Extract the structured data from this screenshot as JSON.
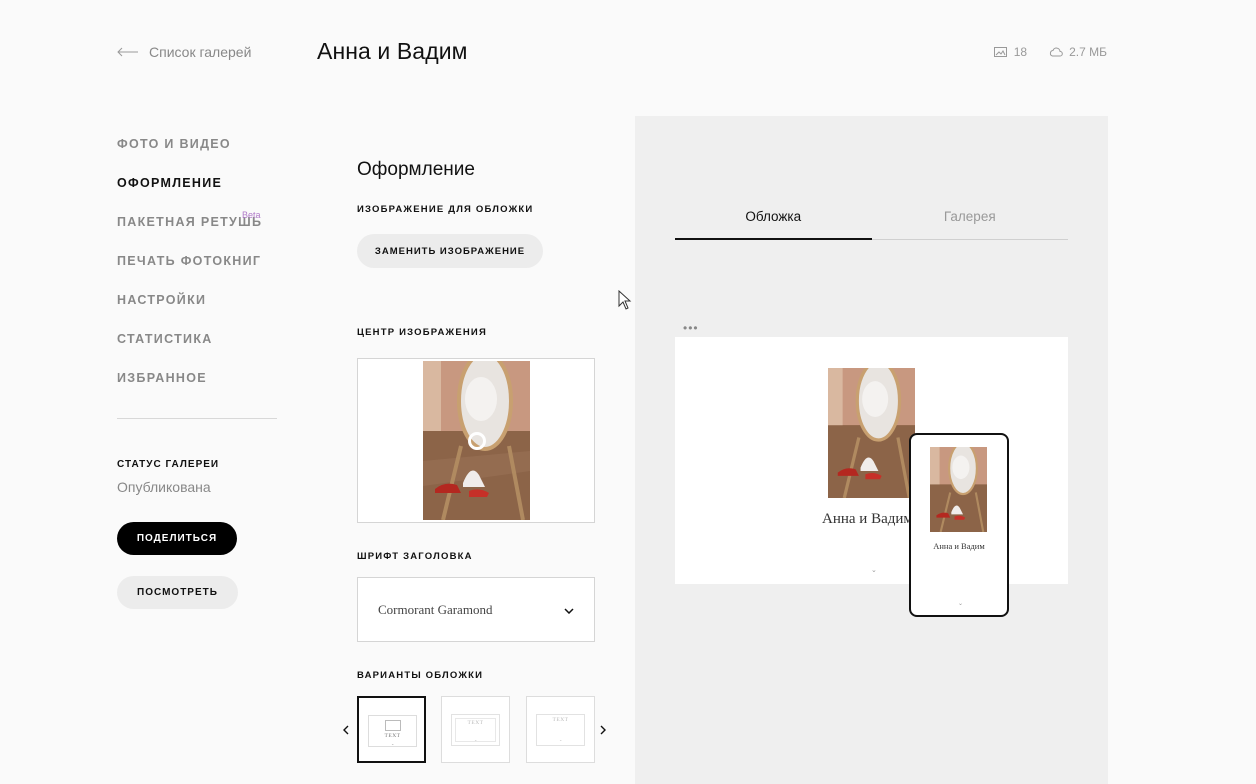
{
  "header": {
    "back_label": "Список галерей",
    "title": "Анна и Вадим",
    "photo_count": "18",
    "storage_used": "2.7 МБ"
  },
  "nav": {
    "items": [
      {
        "label": "ФОТО И ВИДЕО"
      },
      {
        "label": "ОФОРМЛЕНИЕ"
      },
      {
        "label": "ПАКЕТНАЯ РЕТУШЬ",
        "badge": "Beta"
      },
      {
        "label": "ПЕЧАТЬ ФОТОКНИГ"
      },
      {
        "label": "НАСТРОЙКИ"
      },
      {
        "label": "СТАТИСТИКА"
      },
      {
        "label": "ИЗБРАННОЕ"
      }
    ],
    "active_index": 1
  },
  "gallery_status": {
    "label": "СТАТУС ГАЛЕРЕИ",
    "value": "Опубликована"
  },
  "actions": {
    "share_label": "ПОДЕЛИТЬСЯ",
    "view_label": "ПОСМОТРЕТЬ"
  },
  "design": {
    "section_title": "Оформление",
    "cover_image_label": "ИЗОБРАЖЕНИЕ ДЛЯ ОБЛОЖКИ",
    "replace_button": "ЗАМЕНИТЬ ИЗОБРАЖЕНИЕ",
    "focal_label": "ЦЕНТР ИЗОБРАЖЕНИЯ",
    "font_label": "ШРИФТ ЗАГОЛОВКА",
    "font_value": "Cormorant Garamond",
    "variants_label": "ВАРИАНТЫ ОБЛОЖКИ",
    "variant_text": "TEXT",
    "selected_variant": 0
  },
  "preview": {
    "tabs": [
      {
        "label": "Обложка"
      },
      {
        "label": "Галерея"
      }
    ],
    "active_tab": 0,
    "cover_title": "Анна и Вадим",
    "mobile_title": "Анна и Вадим"
  },
  "icons": {
    "back": "arrow-left-icon",
    "photos": "image-icon",
    "storage": "cloud-icon",
    "select": "chevron-down-icon",
    "prev": "chevron-left-icon",
    "next": "chevron-right-icon",
    "more": "more-dots-icon"
  },
  "colors": {
    "accent": "#000000",
    "beta": "#b07ac8",
    "panel": "#efefef"
  }
}
